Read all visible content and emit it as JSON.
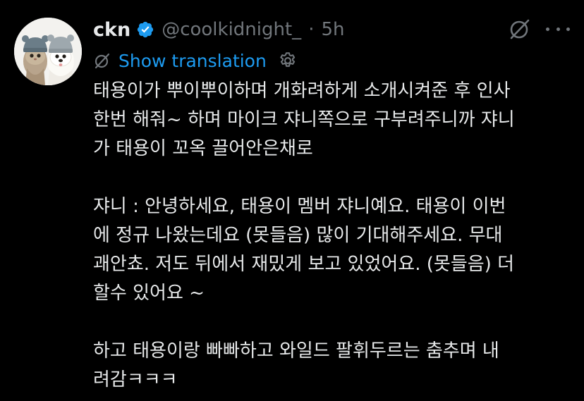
{
  "tweet": {
    "author": {
      "display_name": "ckn",
      "handle": "@coolkidnight_",
      "separator": "·",
      "timestamp": "5h",
      "verified": true
    },
    "translate": {
      "label": "Show translation"
    },
    "paragraphs": [
      "태용이가 뿌이뿌이하며 개화려하게 소개시켜준 후 인사\n한번 해줘~ 하며 마이크 쟈니쪽으로 구부려주니까 쟈니\n가 태용이 꼬옥 끌어안은채로",
      "쟈니 : 안녕하세요, 태용이 멤버 쟈니예요. 태용이 이번\n에 정규 나왔는데요 (못들음) 많이 기대해주세요. 무대\n괘안쵸. 저도 뒤에서 재밌게 보고 있었어요. (못들음) 더\n할수 있어요 ~",
      "하고 태용이랑 빠빠하고 와일드 팔휘두르는 춤추며 내\n려감ㅋㅋㅋ"
    ]
  },
  "icons": {
    "avatar": "two-pets-in-beanies-avatar",
    "verified": "verified-badge-icon",
    "grok": "grok-icon",
    "more": "more-icon",
    "translate": "translate-icon",
    "settings": "settings-icon"
  },
  "colors": {
    "background": "#000000",
    "text_primary": "#e7e9ea",
    "text_secondary": "#71767b",
    "accent": "#1d9bf0"
  }
}
